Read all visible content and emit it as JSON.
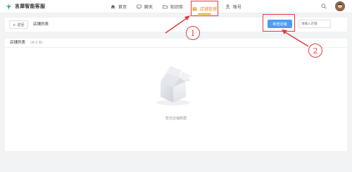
{
  "brand": {
    "name": "言犀智能客服"
  },
  "nav": {
    "home": "首页",
    "chat": "聊天",
    "kb": "知识库",
    "store": "店铺管理",
    "account": "账号"
  },
  "toolbar": {
    "back_label": "返回",
    "page_title": "店铺列表",
    "add_button": "新增店铺",
    "search_placeholder": "请输入店铺"
  },
  "list": {
    "title": "店铺列表",
    "count": "（共 0 条）",
    "empty_text": "暂无店铺数据"
  },
  "annotations": {
    "step1": "1",
    "step2": "2"
  },
  "colors": {
    "accent": "#4e9cf5",
    "highlight": "#e43a3a",
    "nav_active": "#e8892c"
  }
}
